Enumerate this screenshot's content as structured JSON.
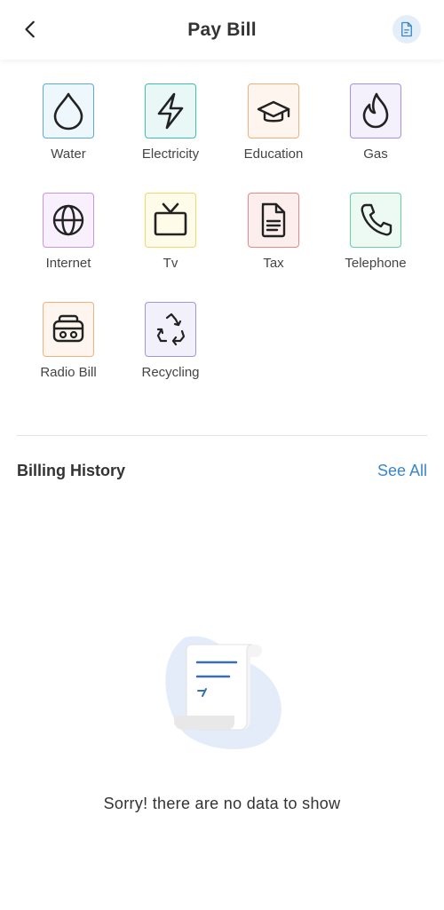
{
  "header": {
    "title": "Pay Bill",
    "back_icon": "chevron-left-icon",
    "document_icon": "document-icon"
  },
  "categories": [
    {
      "label": "Water",
      "icon": "water-drop-icon",
      "color": "#5fa8d8",
      "bg": "#eef7fc"
    },
    {
      "label": "Electricity",
      "icon": "lightning-icon",
      "color": "#3cc0b4",
      "bg": "#e9f8f6"
    },
    {
      "label": "Education",
      "icon": "graduation-cap-icon",
      "color": "#f2b07c",
      "bg": "#fdf5ee"
    },
    {
      "label": "Gas",
      "icon": "flame-icon",
      "color": "#a392e4",
      "bg": "#f4f1fc"
    },
    {
      "label": "Internet",
      "icon": "globe-icon",
      "color": "#c596e2",
      "bg": "#f9f0fd"
    },
    {
      "label": "Tv",
      "icon": "tv-icon",
      "color": "#f2d66a",
      "bg": "#fffbe9"
    },
    {
      "label": "Tax",
      "icon": "document-text-icon",
      "color": "#ec8585",
      "bg": "#fdeeee"
    },
    {
      "label": "Telephone",
      "icon": "phone-icon",
      "color": "#66cfa3",
      "bg": "#ecfaf3"
    },
    {
      "label": "Radio Bill",
      "icon": "radio-icon",
      "color": "#f2b07c",
      "bg": "#fdf5ee"
    },
    {
      "label": "Recycling",
      "icon": "recycle-icon",
      "color": "#9f98d8",
      "bg": "#f1f0fb"
    }
  ],
  "history": {
    "title": "Billing History",
    "see_all": "See All",
    "empty_message": "Sorry! there are no data to show",
    "empty_icon": "empty-receipt-illustration"
  }
}
